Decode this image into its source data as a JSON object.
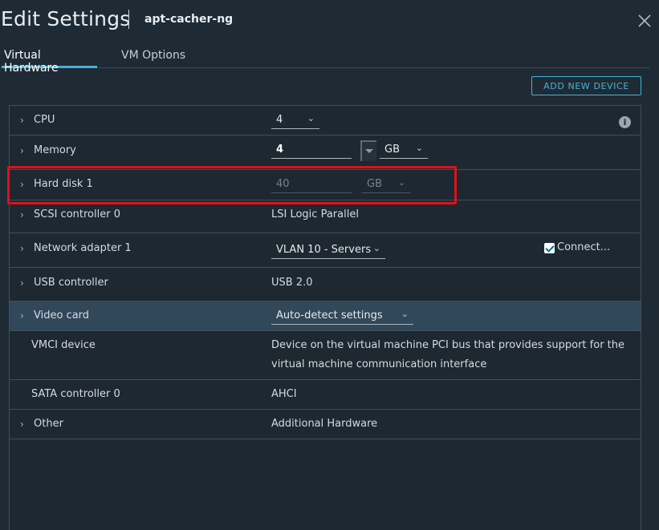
{
  "header": {
    "title": "Edit Settings",
    "subtitle": "apt-cacher-ng",
    "close_icon": "close-icon"
  },
  "tabs": [
    {
      "label": "Virtual Hardware",
      "active": true
    },
    {
      "label": "VM Options",
      "active": false
    }
  ],
  "toolbar": {
    "add_device_label": "ADD NEW DEVICE"
  },
  "rows": {
    "cpu": {
      "label": "CPU",
      "value": "4"
    },
    "memory": {
      "label": "Memory",
      "value": "4",
      "unit": "GB"
    },
    "hard_disk": {
      "label": "Hard disk 1",
      "value": "40",
      "unit": "GB"
    },
    "scsi": {
      "label": "SCSI controller 0",
      "value": "LSI Logic Parallel"
    },
    "network": {
      "label": "Network adapter 1",
      "value": "VLAN 10 - Servers",
      "connect_label": "Connect...",
      "connected": true
    },
    "usb": {
      "label": "USB controller",
      "value": "USB 2.0"
    },
    "video": {
      "label": "Video card",
      "value": "Auto-detect settings"
    },
    "vmci": {
      "label": "VMCI device",
      "value_line1": "Device on the virtual machine PCI bus that provides support for the",
      "value_line2": "virtual machine communication interface"
    },
    "sata": {
      "label": "SATA controller 0",
      "value": "AHCI"
    },
    "other": {
      "label": "Other",
      "value": "Additional Hardware"
    }
  },
  "icons": {
    "info": "i",
    "chevron": "›",
    "caret": "⌄"
  },
  "colors": {
    "accent": "#49afd9",
    "highlight": "#e0101a",
    "selected_row": "#31485a"
  }
}
